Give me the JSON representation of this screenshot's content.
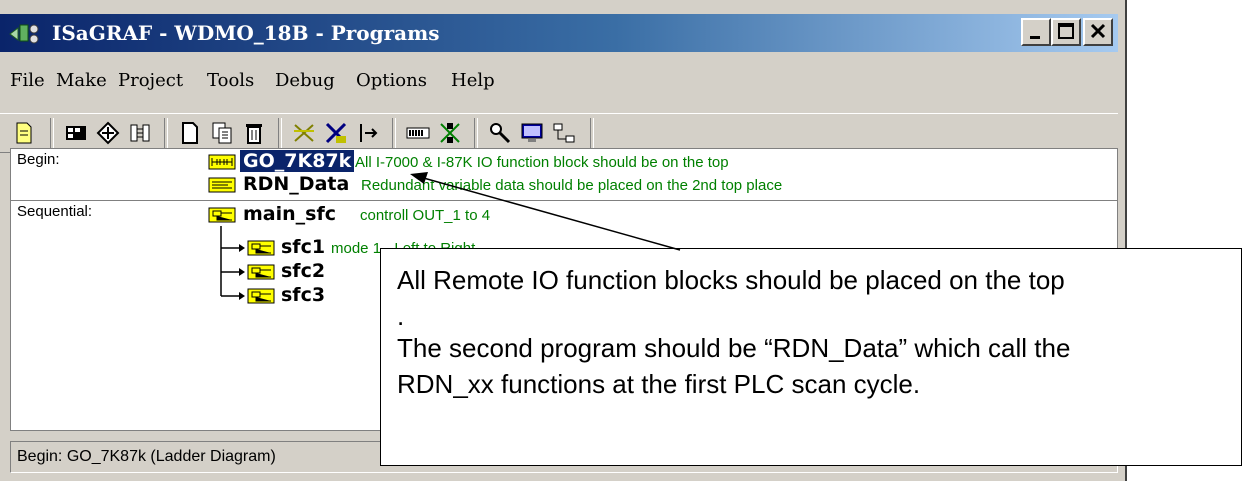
{
  "window": {
    "title": "ISaGRAF - WDMO_18B - Programs"
  },
  "menu": [
    "File",
    "Make",
    "Project",
    "Tools",
    "Debug",
    "Options",
    "Help"
  ],
  "sections": {
    "begin": "Begin:",
    "sequential": "Sequential:"
  },
  "programs": [
    {
      "name": "GO_7K87k",
      "comment": "All I-7000 & I-87K IO function block should be on the top",
      "selected": true
    },
    {
      "name": "RDN_Data",
      "comment": "Redundant variable data should be placed on the 2nd top place"
    },
    {
      "name": "main_sfc",
      "comment": "controll OUT_1 to 4"
    },
    {
      "name": "sfc1",
      "comment": "mode 1 - Left to Right"
    },
    {
      "name": "sfc2",
      "comment": ""
    },
    {
      "name": "sfc3",
      "comment": ""
    }
  ],
  "status": "Begin:  GO_7K87k  (Ladder Diagram)",
  "callout": {
    "line1": "All Remote IO function blocks should be placed on the top",
    "line2": ".",
    "line3": "The second program should be “RDN_Data” which call the",
    "line4": "RDN_xx functions at the first PLC scan cycle."
  },
  "colors": {
    "title_bar": "#0a246a",
    "comment_green": "#008000",
    "selection": "#0a246a"
  },
  "icons": [
    "app-icon",
    "new-file-icon",
    "dictionary-icon",
    "link-icon",
    "io-connection-icon",
    "new-program-icon",
    "copy-icon",
    "delete-icon",
    "compile-icon",
    "verify-icon",
    "step-icon",
    "simulate-icon",
    "debug-icon",
    "tools-icon",
    "monitor-icon",
    "network-icon"
  ]
}
